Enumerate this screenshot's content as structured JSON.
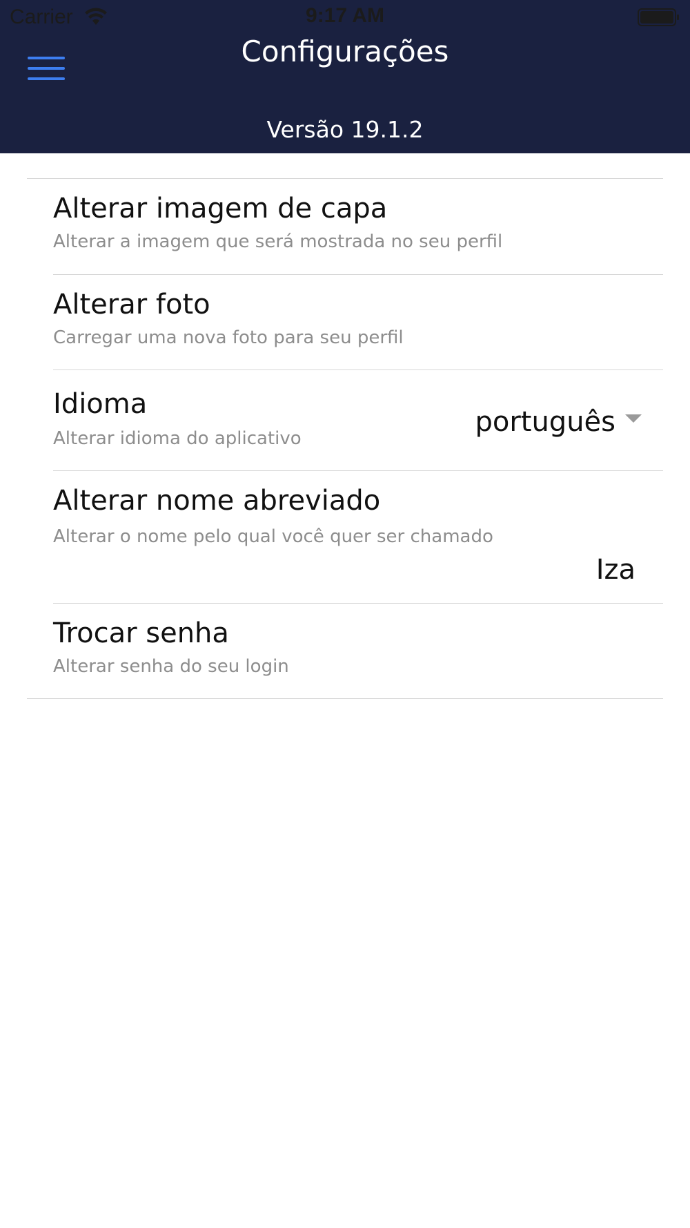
{
  "status_bar": {
    "carrier": "Carrier",
    "time": "9:17 AM"
  },
  "header": {
    "title": "Configurações",
    "version": "Versão 19.1.2",
    "background_color": "#1a2140",
    "menu_icon": "hamburger-menu-icon",
    "menu_icon_color": "#3d7ef0"
  },
  "settings": {
    "cover_image": {
      "title": "Alterar imagem de capa",
      "subtitle": "Alterar a imagem que será mostrada no seu perfil"
    },
    "photo": {
      "title": "Alterar foto",
      "subtitle": "Carregar uma nova foto para seu perfil"
    },
    "language": {
      "title": "Idioma",
      "subtitle": "Alterar idioma do aplicativo",
      "selected": "português"
    },
    "nickname": {
      "title": "Alterar nome abreviado",
      "subtitle": "Alterar o nome pelo qual você quer ser chamado",
      "value": "Iza"
    },
    "password": {
      "title": "Trocar senha",
      "subtitle": "Alterar senha do seu login"
    }
  }
}
